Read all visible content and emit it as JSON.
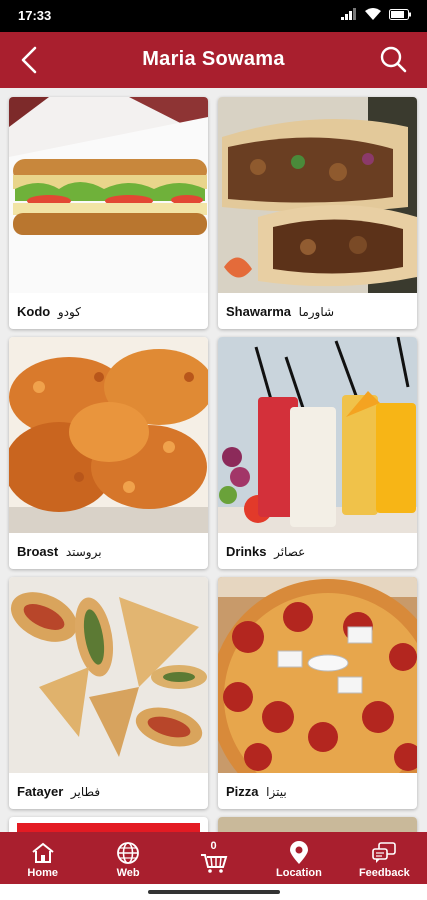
{
  "status": {
    "time": "17:33"
  },
  "header": {
    "title": "Maria Sowama"
  },
  "categories": [
    {
      "name": "Kodo",
      "name_ar": "كودو"
    },
    {
      "name": "Shawarma",
      "name_ar": "شاورما"
    },
    {
      "name": "Broast",
      "name_ar": "بروستد"
    },
    {
      "name": "Drinks",
      "name_ar": "عصائر"
    },
    {
      "name": "Fatayer",
      "name_ar": "فطاير"
    },
    {
      "name": "Pizza",
      "name_ar": "بيتزا"
    }
  ],
  "bottom_nav": [
    {
      "label": "Home",
      "icon": "home-icon"
    },
    {
      "label": "Web",
      "icon": "globe-icon"
    },
    {
      "label": "",
      "icon": "cart-icon",
      "badge": "0"
    },
    {
      "label": "Location",
      "icon": "location-pin-icon"
    },
    {
      "label": "Feedback",
      "icon": "feedback-icon"
    }
  ],
  "colors": {
    "primary": "#a91f2e",
    "background": "#eeeeee"
  }
}
